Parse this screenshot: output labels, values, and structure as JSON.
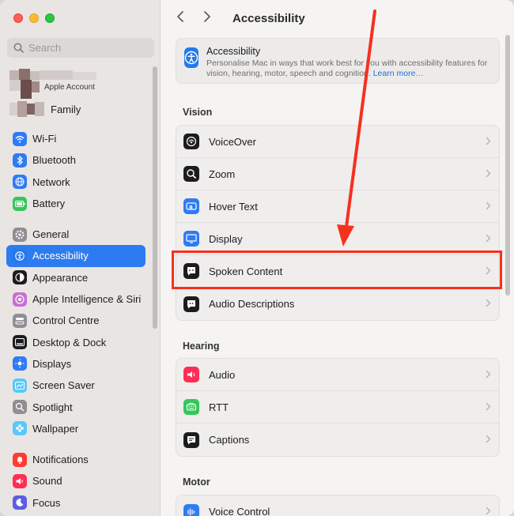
{
  "window": {
    "title": "Accessibility"
  },
  "sidebar": {
    "search_placeholder": "Search",
    "account_label": "Apple Account",
    "family_label": "Family",
    "group1": [
      {
        "label": "Wi-Fi",
        "icon": "wifi-icon",
        "color": "#2f7bf5"
      },
      {
        "label": "Bluetooth",
        "icon": "bluetooth-icon",
        "color": "#2f7bf5"
      },
      {
        "label": "Network",
        "icon": "network-icon",
        "color": "#2f7bf5"
      },
      {
        "label": "Battery",
        "icon": "battery-icon",
        "color": "#34c759"
      }
    ],
    "group2": [
      {
        "label": "General",
        "icon": "gear-icon",
        "color": "#8e8e93"
      },
      {
        "label": "Accessibility",
        "icon": "accessibility-icon",
        "color": "#2478eb",
        "active": true
      },
      {
        "label": "Appearance",
        "icon": "appearance-icon",
        "color": "#1c1c1e"
      },
      {
        "label": "Apple Intelligence & Siri",
        "icon": "siri-icon",
        "color": "#c86dd7"
      },
      {
        "label": "Control Centre",
        "icon": "control-centre-icon",
        "color": "#8e8e93"
      },
      {
        "label": "Desktop & Dock",
        "icon": "dock-icon",
        "color": "#1c1c1e"
      },
      {
        "label": "Displays",
        "icon": "displays-icon",
        "color": "#2f7bf5"
      },
      {
        "label": "Screen Saver",
        "icon": "screen-saver-icon",
        "color": "#5ac8fa"
      },
      {
        "label": "Spotlight",
        "icon": "spotlight-icon",
        "color": "#8e8e93"
      },
      {
        "label": "Wallpaper",
        "icon": "wallpaper-icon",
        "color": "#5ac8fa"
      }
    ],
    "group3": [
      {
        "label": "Notifications",
        "icon": "notifications-icon",
        "color": "#ff3b30"
      },
      {
        "label": "Sound",
        "icon": "sound-icon",
        "color": "#ff2d55"
      },
      {
        "label": "Focus",
        "icon": "focus-icon",
        "color": "#5e5ce6"
      }
    ]
  },
  "banner": {
    "title": "Accessibility",
    "description": "Personalise Mac in ways that work best for you with accessibility features for vision, hearing, motor, speech and cognition.",
    "link": "Learn more…"
  },
  "sections": {
    "vision": {
      "title": "Vision",
      "rows": [
        {
          "label": "VoiceOver",
          "icon": "voiceover-icon",
          "color": "#1c1c1e"
        },
        {
          "label": "Zoom",
          "icon": "zoom-icon",
          "color": "#1c1c1e"
        },
        {
          "label": "Hover Text",
          "icon": "hover-text-icon",
          "color": "#2f7bf5"
        },
        {
          "label": "Display",
          "icon": "display-icon",
          "color": "#2f7bf5"
        },
        {
          "label": "Spoken Content",
          "icon": "spoken-content-icon",
          "color": "#1c1c1e"
        },
        {
          "label": "Audio Descriptions",
          "icon": "audio-descriptions-icon",
          "color": "#1c1c1e"
        }
      ]
    },
    "hearing": {
      "title": "Hearing",
      "rows": [
        {
          "label": "Audio",
          "icon": "audio-icon",
          "color": "#ff2d55"
        },
        {
          "label": "RTT",
          "icon": "rtt-icon",
          "color": "#34c759"
        },
        {
          "label": "Captions",
          "icon": "captions-icon",
          "color": "#1c1c1e"
        }
      ]
    },
    "motor": {
      "title": "Motor",
      "rows": [
        {
          "label": "Voice Control",
          "icon": "voice-control-icon",
          "color": "#2f7bf5"
        }
      ]
    }
  },
  "colors": {
    "accent": "#2d7bf0",
    "annotation": "#f7301e"
  }
}
